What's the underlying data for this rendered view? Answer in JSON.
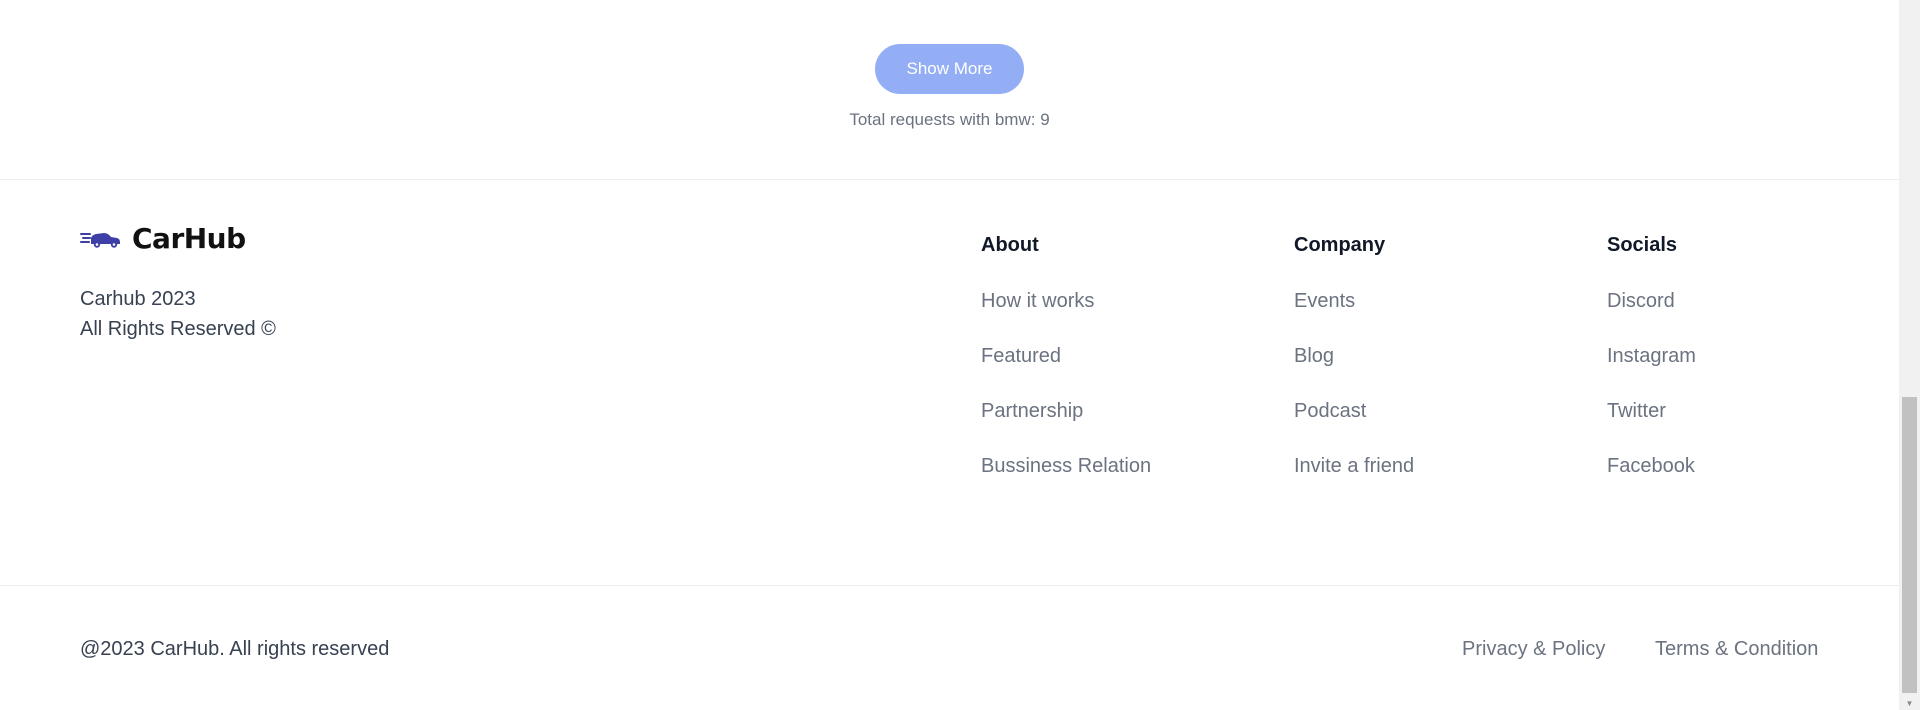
{
  "results": {
    "show_more_label": "Show More",
    "total_requests_text": "Total requests with bmw: 9"
  },
  "brand": {
    "name": "CarHub",
    "logo_icon": "car-logo-icon",
    "line1": "Carhub 2023",
    "line2": "All Rights Reserved ©"
  },
  "footer": {
    "columns": [
      {
        "title": "About",
        "links": [
          "How it works",
          "Featured",
          "Partnership",
          "Bussiness Relation"
        ]
      },
      {
        "title": "Company",
        "links": [
          "Events",
          "Blog",
          "Podcast",
          "Invite a friend"
        ]
      },
      {
        "title": "Socials",
        "links": [
          "Discord",
          "Instagram",
          "Twitter",
          "Facebook"
        ]
      }
    ],
    "copyright": "@2023 CarHub. All rights reserved",
    "privacy_label": "Privacy & Policy",
    "terms_label": "Terms & Condition"
  },
  "colors": {
    "accent": "#93aef5",
    "logo": "#3f3fa8",
    "muted_text": "#6b7280",
    "heading": "#111827"
  }
}
